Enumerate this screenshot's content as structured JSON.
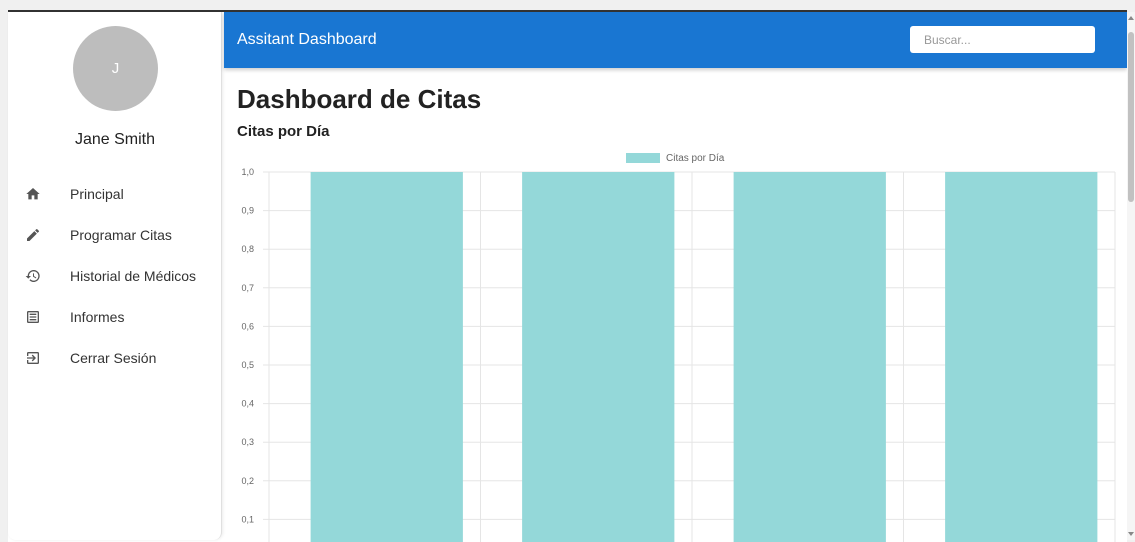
{
  "header": {
    "title": "Assitant Dashboard",
    "search_placeholder": "Buscar..."
  },
  "user": {
    "initial": "J",
    "name": "Jane Smith"
  },
  "sidebar": {
    "items": [
      {
        "label": "Principal",
        "icon": "home-icon"
      },
      {
        "label": "Programar Citas",
        "icon": "pencil-icon"
      },
      {
        "label": "Historial de Médicos",
        "icon": "history-icon"
      },
      {
        "label": "Informes",
        "icon": "report-icon"
      },
      {
        "label": "Cerrar Sesión",
        "icon": "logout-icon"
      }
    ]
  },
  "main": {
    "page_title": "Dashboard de Citas",
    "section_title": "Citas por Día"
  },
  "colors": {
    "header": "#1976d2",
    "bar_fill": "#94d8d9",
    "avatar": "#bdbdbd"
  },
  "chart_data": {
    "type": "bar",
    "legend": "Citas por Día",
    "legend_position": "top",
    "grid": true,
    "y_ticks": [
      "1,0",
      "0,9",
      "0,8",
      "0,7",
      "0,6",
      "0,5",
      "0,4",
      "0,3",
      "0,2",
      "0,1"
    ],
    "ylim": [
      0,
      1
    ],
    "series": [
      {
        "name": "Citas por Día",
        "values": [
          1,
          1,
          1,
          1
        ]
      }
    ]
  }
}
